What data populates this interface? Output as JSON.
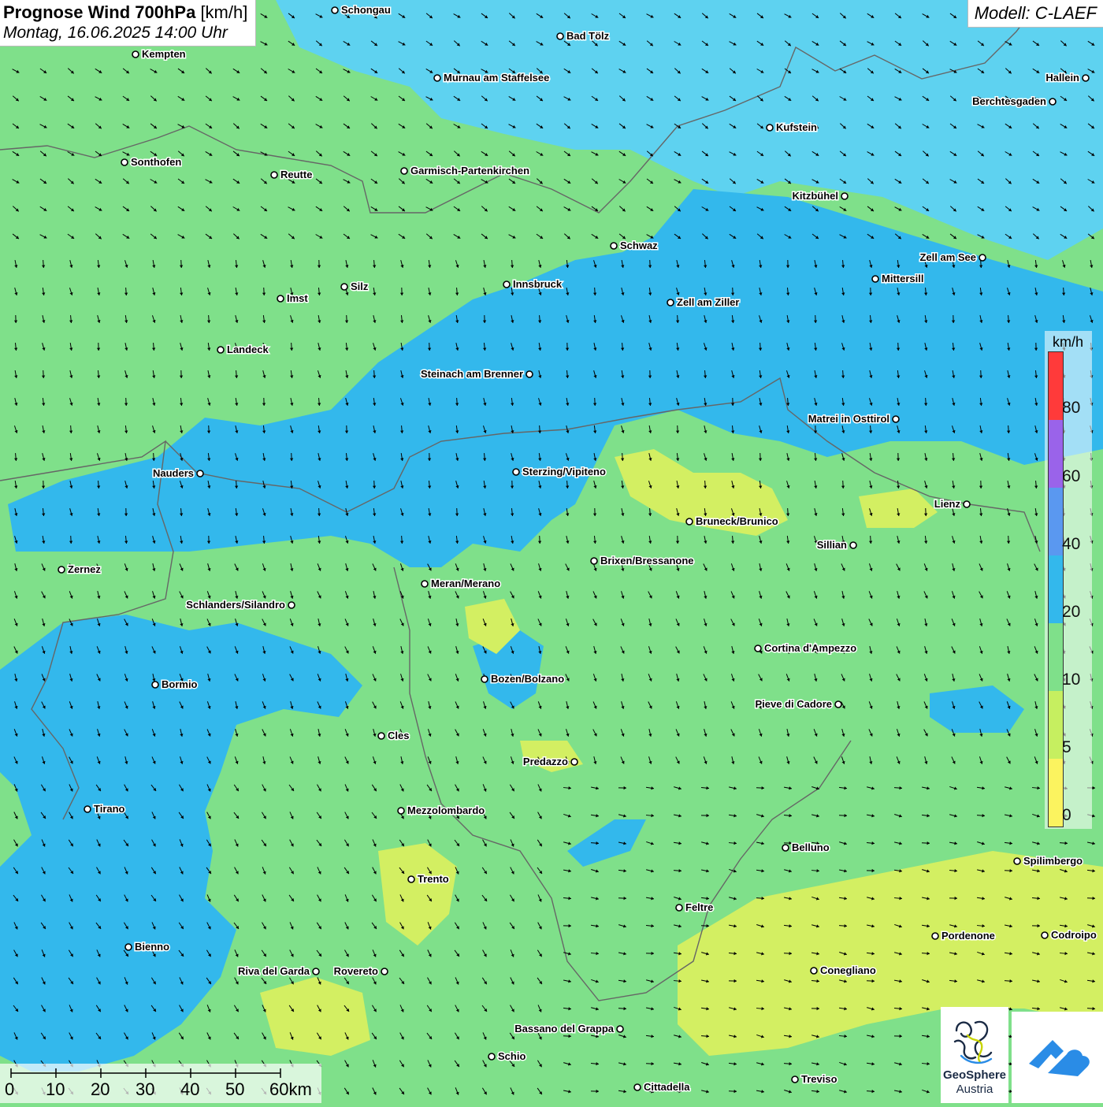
{
  "title": {
    "main": "Prognose Wind 700hPa",
    "unit": "[km/h]",
    "date": "Montag, 16.06.2025 14:00 Uhr"
  },
  "model": "Modell: C-LAEF",
  "legend": {
    "unit": "km/h",
    "ticks": [
      "80",
      "60",
      "40",
      "20",
      "10",
      "5",
      "0"
    ],
    "colors": [
      "#ff3a3a",
      "#9a63ea",
      "#5a98f0",
      "#33b8ec",
      "#7fe08a",
      "#c6ef60",
      "#fbf35f"
    ]
  },
  "scalebar": {
    "labels": [
      "0",
      "10",
      "20",
      "30",
      "40",
      "50",
      "60km"
    ]
  },
  "logo": {
    "name": "GeoSphere",
    "sub": "Austria",
    "colors": {
      "navy": "#1a2a44",
      "blue": "#2a8ce6"
    }
  },
  "map": {
    "colors": {
      "background": "#7fe08a",
      "blue_zone": "#33b8ec",
      "light_blue_zone": "#5ed2f0",
      "yellow_zone": "#d3ef62",
      "border": "#666666",
      "arrow": "#000000"
    },
    "cities": [
      {
        "name": "Schongau"
      },
      {
        "name": "Bad Tölz"
      },
      {
        "name": "Kempten"
      },
      {
        "name": "Murnau am Staffelsee"
      },
      {
        "name": "Hallein"
      },
      {
        "name": "Berchtesgaden"
      },
      {
        "name": "Kufstein"
      },
      {
        "name": "Sonthofen"
      },
      {
        "name": "Reutte"
      },
      {
        "name": "Garmisch-Partenkirchen"
      },
      {
        "name": "Kitzbühel"
      },
      {
        "name": "Schwaz"
      },
      {
        "name": "Zell am See"
      },
      {
        "name": "Mittersill"
      },
      {
        "name": "Innsbruck"
      },
      {
        "name": "Silz"
      },
      {
        "name": "Imst"
      },
      {
        "name": "Zell am Ziller"
      },
      {
        "name": "Landeck"
      },
      {
        "name": "Steinach am Brenner"
      },
      {
        "name": "Matrei in Osttirol"
      },
      {
        "name": "Nauders"
      },
      {
        "name": "Sterzing/Vipiteno"
      },
      {
        "name": "Lienz"
      },
      {
        "name": "Bruneck/Brunico"
      },
      {
        "name": "Sillian"
      },
      {
        "name": "Zernez"
      },
      {
        "name": "Brixen/Bressanone"
      },
      {
        "name": "Meran/Merano"
      },
      {
        "name": "Schlanders/Silandro"
      },
      {
        "name": "Cortina d'Ampezzo"
      },
      {
        "name": "Bozen/Bolzano"
      },
      {
        "name": "Bormio"
      },
      {
        "name": "Pieve di Cadore"
      },
      {
        "name": "Cles"
      },
      {
        "name": "Predazzo"
      },
      {
        "name": "Tirano"
      },
      {
        "name": "Mezzolombardo"
      },
      {
        "name": "Belluno"
      },
      {
        "name": "Spilimbergo"
      },
      {
        "name": "Trento"
      },
      {
        "name": "Feltre"
      },
      {
        "name": "Bienno"
      },
      {
        "name": "Pordenone"
      },
      {
        "name": "Codroipo"
      },
      {
        "name": "Riva del Garda"
      },
      {
        "name": "Rovereto"
      },
      {
        "name": "Conegliano"
      },
      {
        "name": "Bassano del Grappa"
      },
      {
        "name": "Schio"
      },
      {
        "name": "Treviso"
      },
      {
        "name": "Cittadella"
      }
    ]
  }
}
